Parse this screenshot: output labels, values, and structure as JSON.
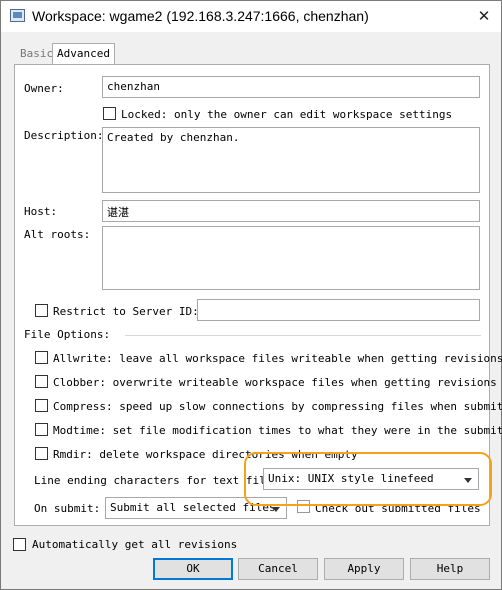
{
  "window": {
    "title": "Workspace: wgame2 (192.168.3.247:1666,  chenzhan)",
    "close_glyph": "✕"
  },
  "tabs": [
    {
      "label": "Basic",
      "selected": false
    },
    {
      "label": "Advanced",
      "selected": true
    }
  ],
  "form": {
    "owner_label": "Owner:",
    "owner_value": "chenzhan",
    "locked_label": "Locked: only the owner can edit workspace settings",
    "locked_checked": false,
    "description_label": "Description:",
    "description_value": "Created by chenzhan.",
    "host_label": "Host:",
    "host_value": "谌湛",
    "altroots_label": "Alt roots:",
    "altroots_value": "",
    "restrict_label": "Restrict to Server ID:",
    "restrict_checked": false,
    "restrict_value": "",
    "file_options_label": "File Options:"
  },
  "file_options": [
    {
      "label": "Allwrite: leave all workspace files writeable when getting revisions",
      "checked": false
    },
    {
      "label": "Clobber: overwrite writeable workspace files when getting revisions",
      "checked": false
    },
    {
      "label": "Compress: speed up slow connections by compressing files when submittin",
      "checked": false
    },
    {
      "label": "Modtime: set file modification times to what they were in the submitter",
      "checked": false
    },
    {
      "label": "Rmdir: delete workspace directories when empty",
      "checked": false
    }
  ],
  "line_ending": {
    "label": "Line ending characters for text file:",
    "value": "Unix: UNIX style linefeed"
  },
  "on_submit": {
    "label": "On submit:",
    "value": "Submit all selected files",
    "checkout_label": "Check out submitted files a",
    "checkout_checked": false
  },
  "auto_get": {
    "label": "Automatically get all revisions",
    "checked": false
  },
  "buttons": {
    "ok": "OK",
    "cancel": "Cancel",
    "apply": "Apply",
    "help": "Help"
  },
  "colors": {
    "highlight": "#f4a21a",
    "default_button_border": "#0078d7"
  }
}
